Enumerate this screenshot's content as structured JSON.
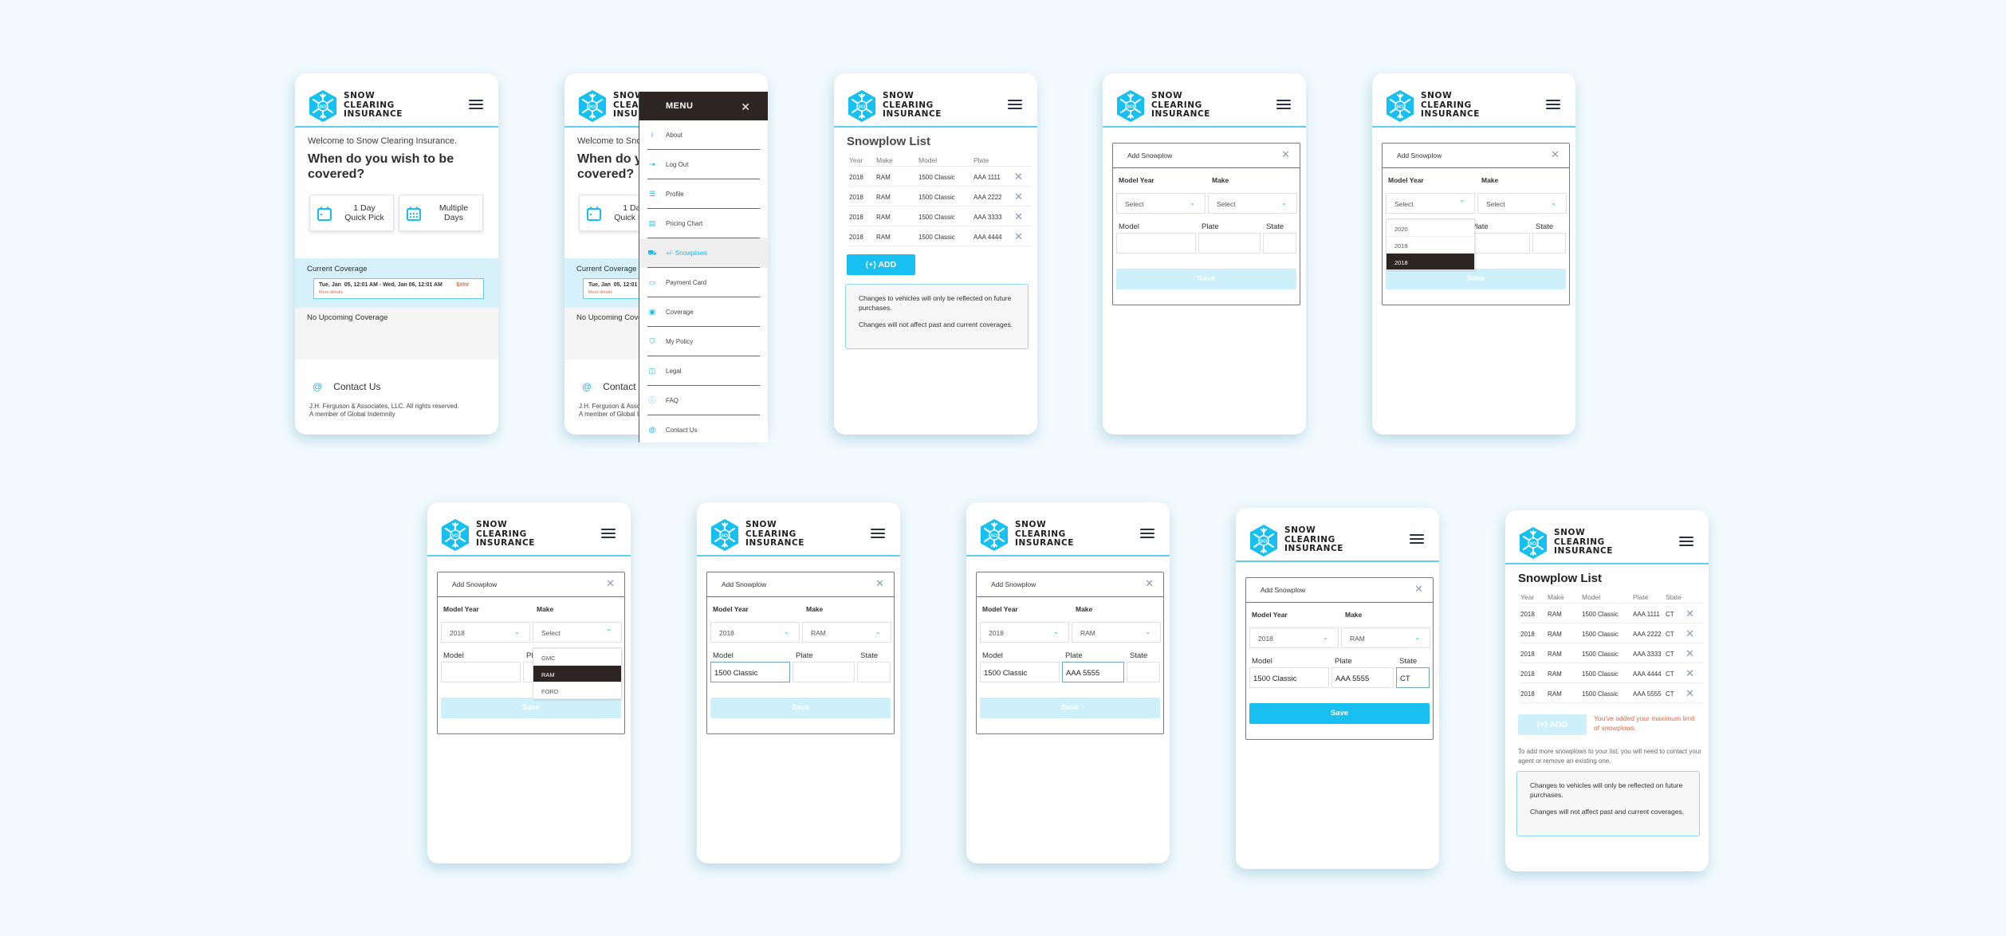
{
  "brand": {
    "name_lines": [
      "SNOW",
      "CLEARING",
      "INSURANCE"
    ],
    "logo_text": "SCI",
    "accent": "#17c0f0",
    "menu_dark": "#2c2521",
    "warning": "#e36b3f"
  },
  "home": {
    "welcome": "Welcome to Snow Clearing Insurance.",
    "question": "When do you wish to be covered?",
    "options": [
      {
        "label_line1": "1 Day",
        "label_line2": "Quick Pick",
        "icon": "calendar-single-icon"
      },
      {
        "label_line1": "Multiple",
        "label_line2": "Days",
        "icon": "calendar-grid-icon"
      }
    ],
    "current_coverage_title": "Current Coverage",
    "coverage_dates": "Tue, Jan  05, 12:01 AM - Wed, Jan 06, 12:01 AM",
    "coverage_price": "$###",
    "coverage_more": "More details",
    "upcoming": "No Upcoming Coverage",
    "contact": "Contact Us",
    "contact_icon": "@",
    "legal_line1": "J.H. Ferguson & Associates, LLC. All rights reserved.",
    "legal_line2": "A member of Global Indemnity"
  },
  "menu": {
    "title": "MENU",
    "close": "✕",
    "items": [
      {
        "label": "About",
        "icon": "i"
      },
      {
        "label": "Log Out",
        "icon": "⇥"
      },
      {
        "label": "Profile",
        "icon": "☰"
      },
      {
        "label": "Pricing Chart",
        "icon": "▤"
      },
      {
        "label": "+/- Snowplows",
        "icon": "⛟",
        "active": true
      },
      {
        "label": "Payment Card",
        "icon": "▭"
      },
      {
        "label": "Coverage",
        "icon": "▣"
      },
      {
        "label": "My Policy",
        "icon": "⛉"
      },
      {
        "label": "Legal",
        "icon": "◫"
      },
      {
        "label": "FAQ",
        "icon": "ⓘ"
      },
      {
        "label": "Contact Us",
        "icon": "@"
      }
    ]
  },
  "list": {
    "title": "Snowplow List",
    "headers": [
      "Year",
      "Make",
      "Model",
      "Plate",
      "State"
    ],
    "rows_initial": [
      {
        "year": "2018",
        "make": "RAM",
        "model": "1500 Classic",
        "plate": "AAA 1111"
      },
      {
        "year": "2018",
        "make": "RAM",
        "model": "1500 Classic",
        "plate": "AAA 2222"
      },
      {
        "year": "2018",
        "make": "RAM",
        "model": "1500 Classic",
        "plate": "AAA 3333"
      },
      {
        "year": "2018",
        "make": "RAM",
        "model": "1500 Classic",
        "plate": "AAA 4444"
      }
    ],
    "rows_full": [
      {
        "year": "2018",
        "make": "RAM",
        "model": "1500 Classic",
        "plate": "AAA 1111",
        "state": "CT"
      },
      {
        "year": "2018",
        "make": "RAM",
        "model": "1500 Classic",
        "plate": "AAA 2222",
        "state": "CT"
      },
      {
        "year": "2018",
        "make": "RAM",
        "model": "1500 Classic",
        "plate": "AAA 3333",
        "state": "CT"
      },
      {
        "year": "2018",
        "make": "RAM",
        "model": "1500 Classic",
        "plate": "AAA 4444",
        "state": "CT"
      },
      {
        "year": "2018",
        "make": "RAM",
        "model": "1500 Classic",
        "plate": "AAA 5555",
        "state": "CT"
      }
    ],
    "add_label": "(+) ADD",
    "remove_icon": "✕",
    "info_1": "Changes to vehicles will only be reflected on future purchases.",
    "info_2": "Changes will not affect past and current coverages.",
    "max_msg": "You've added your maximum limit of snowplows.",
    "more_info": "To add more snowplows to your list, you will need to contact your agent or remove an existing one."
  },
  "modal": {
    "title": "Add Snowplow",
    "close": "✕",
    "year_label": "Model Year",
    "make_label": "Make",
    "model_label": "Model",
    "plate_label": "Plate",
    "state_label": "State",
    "select_placeholder": "Select",
    "save": "Save",
    "year_options": [
      "2020",
      "2019",
      "2018"
    ],
    "make_options": [
      "GMC",
      "RAM",
      "FORD"
    ],
    "chev_down": "⌄",
    "chev_up": "⌃"
  },
  "states": [
    {
      "year": "",
      "make": "",
      "model": "",
      "plate": "",
      "state": ""
    },
    {
      "year": "",
      "make": "",
      "model": "",
      "plate": "",
      "state": "",
      "open": "year",
      "highlight": "2018"
    },
    {
      "year": "2018",
      "make": "",
      "model": "",
      "plate": "",
      "state": "",
      "open": "make",
      "highlight": "RAM"
    },
    {
      "year": "2018",
      "make": "RAM",
      "model": "1500 Classic",
      "plate": "",
      "state": "",
      "focus": "model"
    },
    {
      "year": "2018",
      "make": "RAM",
      "model": "1500 Classic",
      "plate": "AAA 5555",
      "state": "",
      "focus": "plate"
    },
    {
      "year": "2018",
      "make": "RAM",
      "model": "1500 Classic",
      "plate": "AAA 5555",
      "state": "CT",
      "focus": "state",
      "save_enabled": true
    }
  ]
}
